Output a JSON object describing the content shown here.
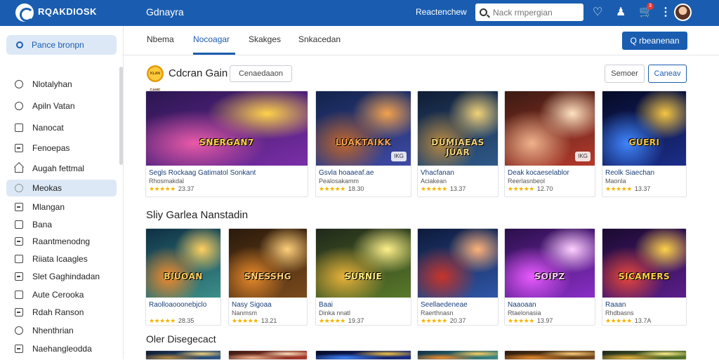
{
  "header": {
    "logo_text": "RQAKDIOSK",
    "title": "Gdnayra",
    "link": "Reactenchew",
    "search_placeholder": "Nack rmpergian",
    "cart_count": "3",
    "icons": [
      "heart-icon",
      "user-icon",
      "cart-icon",
      "more-vertical-icon"
    ]
  },
  "sidebar": {
    "search_label": "Pance bronpn",
    "items": [
      {
        "label": "Nlotalyhan",
        "icon": "circle-icon"
      },
      {
        "label": "Apiln Vatan",
        "icon": "circle-icon"
      },
      {
        "label": "Nanocat",
        "icon": "square-icon"
      },
      {
        "label": "Fenoepas",
        "icon": "box-icon"
      },
      {
        "label": "Augah fettmal",
        "icon": "house-icon"
      },
      {
        "label": "Meokas",
        "icon": "gear-icon",
        "active": true
      },
      {
        "label": "Mlangan",
        "icon": "box-icon"
      },
      {
        "label": "Bana",
        "icon": "square-icon"
      },
      {
        "label": "Raantmenodng",
        "icon": "box-icon"
      },
      {
        "label": "Riiata Icaagles",
        "icon": "square-icon"
      },
      {
        "label": "Slet Gaghindadan",
        "icon": "box-icon"
      },
      {
        "label": "Aute Cerooka",
        "icon": "square-icon"
      },
      {
        "label": "Rdah Ranson",
        "icon": "box-icon"
      },
      {
        "label": "Nhenthrian",
        "icon": "circle-icon"
      },
      {
        "label": "Naehangleodda",
        "icon": "box-icon"
      }
    ]
  },
  "tabs": [
    {
      "label": "Nbema"
    },
    {
      "label": "Nocoagar",
      "active": true
    },
    {
      "label": "Skakges"
    },
    {
      "label": "Snkacedan"
    }
  ],
  "primary_button": "Q rbeanenan",
  "featured": {
    "title": "Cdcran Gain",
    "badge": "KLAN GAME",
    "chip": "Cenaedaaon",
    "btn_secondary": "Semoer",
    "btn_primary": "Caneav",
    "cards": [
      {
        "thumb": "SNERGAN7",
        "title": "Segls Rockaag Gatimatol Sonkant",
        "sub": "Rhosmakdal",
        "rating": "23.37"
      },
      {
        "thumb": "LUAKTAIKK",
        "title": "Gsvla hoaaeaf.ae",
        "sub": "Pealosakamm",
        "rating": "18.30",
        "tag": "IKG"
      },
      {
        "thumb": "DUMIAEAS JUAR",
        "title": "Vhacfanan",
        "sub": "Aciakean",
        "rating": "13.37"
      },
      {
        "thumb": "",
        "title": "Deak kocaeselablor",
        "sub": "Reerlasnbeol",
        "rating": "12.70",
        "tag": "IKG"
      },
      {
        "thumb": "GUERI",
        "title": "Reolk Siaechan",
        "sub": "Maonla",
        "rating": "13.37"
      }
    ]
  },
  "section2": {
    "title": "Sliy Garlea Nanstadin",
    "cards": [
      {
        "thumb": "BIUOAN",
        "title": "Raolloaooonebjclo",
        "sub": "",
        "rating": "28.35"
      },
      {
        "thumb": "SNESSHG",
        "title": "Nasy Sigoaa",
        "sub": "Nanmsm",
        "rating": "13.21"
      },
      {
        "thumb": "SURNIE",
        "title": "Baai",
        "sub": "Dinka nnatl",
        "rating": "19.37"
      },
      {
        "thumb": "",
        "title": "Seellaedeneae",
        "sub": "Raerthnasn",
        "rating": "20.37"
      },
      {
        "thumb": "SOIPZ",
        "title": "Naaoaan",
        "sub": "Rtaelonasia",
        "rating": "13.97"
      },
      {
        "thumb": "SICAMERS",
        "title": "Raaan",
        "sub": "Rhdbasns",
        "rating": "13.7A"
      }
    ]
  },
  "section3": {
    "title": "Oler Disegecact"
  }
}
